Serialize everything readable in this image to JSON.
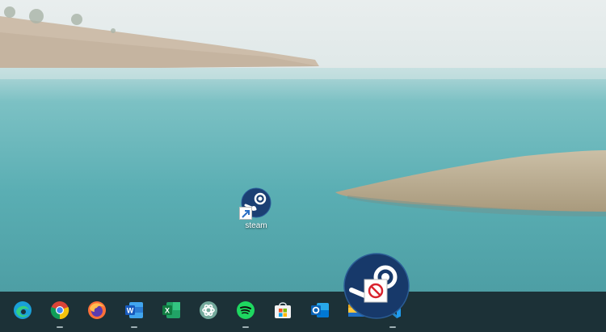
{
  "colors": {
    "sky": "#e7eced",
    "water": "#5fb3b7",
    "shore": "#c9bba6",
    "grass": "#b8a98d",
    "taskbar": "#1c3137",
    "steam_blue": "#1b3f73"
  },
  "desktop": {
    "icons": [
      {
        "label": "steam",
        "icon": "steam-shortcut-icon"
      }
    ]
  },
  "taskbar": {
    "apps": [
      {
        "icon": "edge-icon",
        "running": false
      },
      {
        "icon": "chrome-icon",
        "running": true
      },
      {
        "icon": "firefox-icon",
        "running": false
      },
      {
        "icon": "word-icon",
        "running": true
      },
      {
        "icon": "excel-icon",
        "running": false
      },
      {
        "icon": "chatgpt-icon",
        "running": false
      },
      {
        "icon": "spotify-icon",
        "running": true
      },
      {
        "icon": "microsoft-store-icon",
        "running": false
      },
      {
        "icon": "outlook-icon",
        "running": false
      },
      {
        "icon": "file-explorer-icon",
        "running": false
      },
      {
        "icon": "vscode-icon",
        "running": true
      }
    ]
  },
  "drag_feedback": {
    "icon": "steam-icon",
    "cursor": "no-drop-icon"
  }
}
